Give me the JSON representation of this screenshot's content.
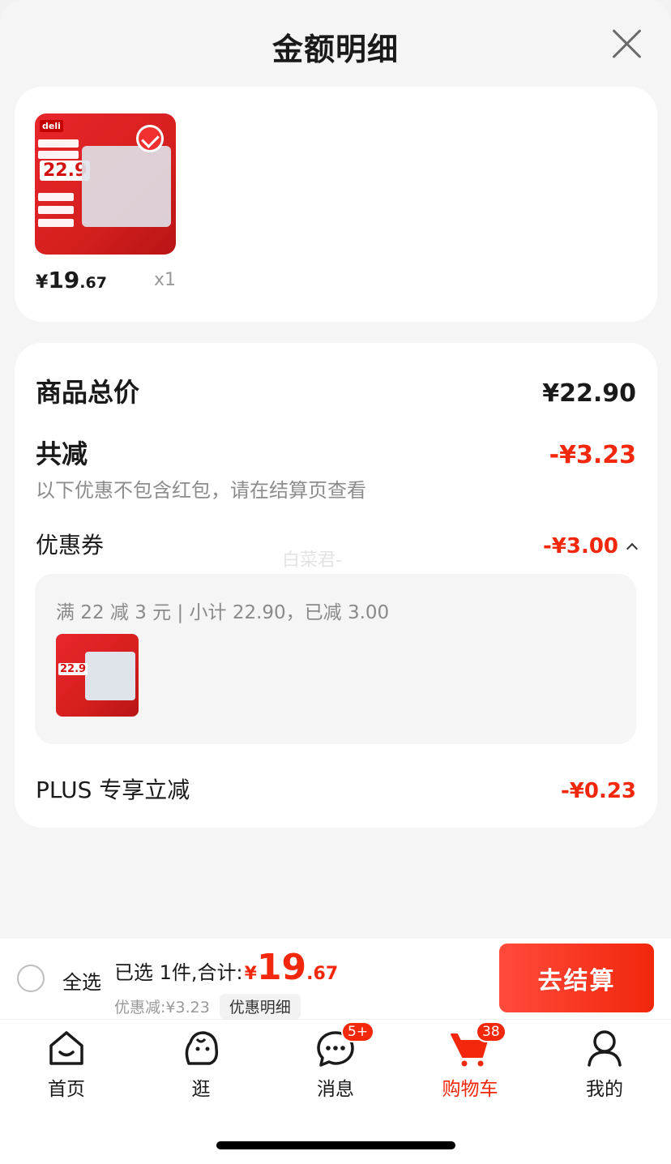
{
  "header": {
    "title": "金额明细"
  },
  "product": {
    "image_logo": "deli",
    "image_price_tag": "22.9",
    "price_yen": "¥",
    "price_int": "19",
    "price_dec": ".67",
    "quantity": "x1"
  },
  "summary": {
    "total_label": "商品总价",
    "total_value": "¥22.90",
    "reduce_label": "共减",
    "reduce_value": "-¥3.23",
    "reduce_note": "以下优惠不包含红包，请在结算页查看",
    "coupon_label": "优惠券",
    "coupon_value": "-¥3.00",
    "watermark": "白菜君-",
    "coupon_detail": "满 22 减 3 元 | 小计 22.90，已减 3.00",
    "plus_label": "PLUS 专享立减",
    "plus_value": "-¥0.23"
  },
  "bottom_bar": {
    "select_all": "全选",
    "selected_text": "已选 1件,合计:",
    "total_yen": "¥",
    "total_int": "19",
    "total_dec": ".67",
    "discount_text": "优惠减:¥3.23",
    "detail_button": "优惠明细",
    "checkout_button": "去结算"
  },
  "tabbar": {
    "items": [
      {
        "label": "首页",
        "icon": "home-icon"
      },
      {
        "label": "逛",
        "icon": "browse-icon"
      },
      {
        "label": "消息",
        "icon": "message-icon",
        "badge": "5+"
      },
      {
        "label": "购物车",
        "icon": "cart-icon",
        "badge": "38",
        "active": true
      },
      {
        "label": "我的",
        "icon": "profile-icon"
      }
    ]
  },
  "colors": {
    "accent": "#f2270c",
    "muted": "#8c8c8c",
    "background": "#f5f5f5"
  }
}
